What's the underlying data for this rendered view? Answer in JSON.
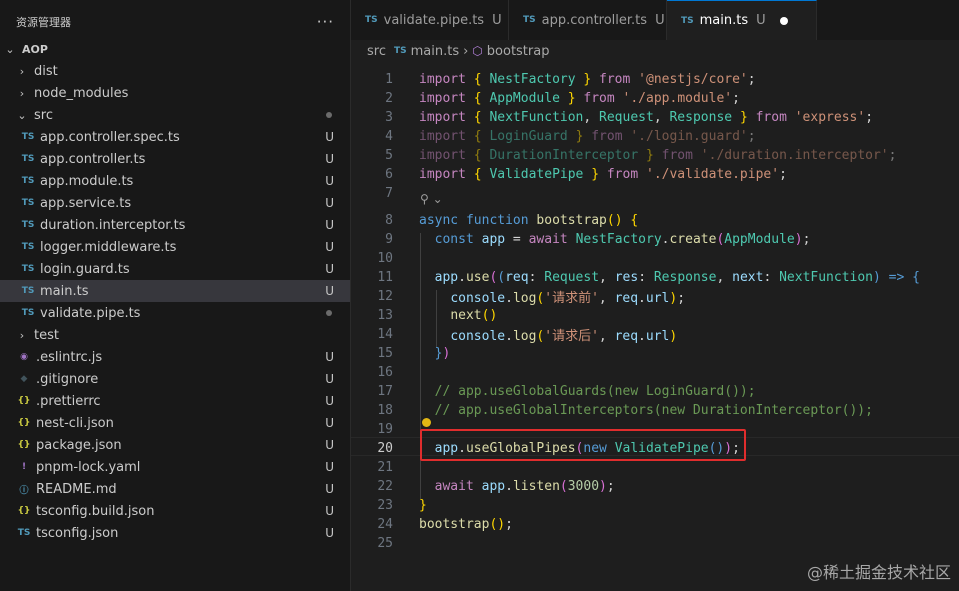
{
  "explorer": {
    "title": "资源管理器",
    "more": "···",
    "root": "AOP",
    "items": [
      {
        "label": "dist",
        "type": "folder",
        "icon": "chevron-right-icon",
        "depth": 1
      },
      {
        "label": "node_modules",
        "type": "folder",
        "icon": "chevron-right-icon",
        "depth": 1
      },
      {
        "label": "src",
        "type": "folder-open",
        "icon": "chevron-down-icon",
        "depth": 1,
        "dot": true
      },
      {
        "label": "app.controller.spec.ts",
        "type": "ts",
        "depth": 2,
        "status": "U"
      },
      {
        "label": "app.controller.ts",
        "type": "ts",
        "depth": 2,
        "status": "U"
      },
      {
        "label": "app.module.ts",
        "type": "ts",
        "depth": 2,
        "status": "U"
      },
      {
        "label": "app.service.ts",
        "type": "ts",
        "depth": 2,
        "status": "U"
      },
      {
        "label": "duration.interceptor.ts",
        "type": "ts",
        "depth": 2,
        "status": "U"
      },
      {
        "label": "logger.middleware.ts",
        "type": "ts",
        "depth": 2,
        "status": "U"
      },
      {
        "label": "login.guard.ts",
        "type": "ts",
        "depth": 2,
        "status": "U"
      },
      {
        "label": "main.ts",
        "type": "ts",
        "depth": 2,
        "status": "U",
        "selected": true
      },
      {
        "label": "validate.pipe.ts",
        "type": "ts",
        "depth": 2,
        "dot": true
      },
      {
        "label": "test",
        "type": "folder",
        "icon": "chevron-right-icon",
        "depth": 1
      },
      {
        "label": ".eslintrc.js",
        "type": "eslint",
        "depth": 1,
        "status": "U"
      },
      {
        "label": ".gitignore",
        "type": "git",
        "depth": 1,
        "status": "U"
      },
      {
        "label": ".prettierrc",
        "type": "json",
        "depth": 1,
        "status": "U"
      },
      {
        "label": "nest-cli.json",
        "type": "json",
        "depth": 1,
        "status": "U"
      },
      {
        "label": "package.json",
        "type": "json",
        "depth": 1,
        "status": "U"
      },
      {
        "label": "pnpm-lock.yaml",
        "type": "yaml",
        "depth": 1,
        "status": "U"
      },
      {
        "label": "README.md",
        "type": "md",
        "depth": 1,
        "status": "U"
      },
      {
        "label": "tsconfig.build.json",
        "type": "json",
        "depth": 1,
        "status": "U"
      },
      {
        "label": "tsconfig.json",
        "type": "tsconfig",
        "depth": 1,
        "status": "U"
      }
    ]
  },
  "tabs": [
    {
      "label": "validate.pipe.ts",
      "status": "U",
      "active": false
    },
    {
      "label": "app.controller.ts",
      "status": "U",
      "active": false
    },
    {
      "label": "main.ts",
      "status": "U",
      "active": true,
      "modified": true
    }
  ],
  "icons": {
    "ts": "TS",
    "json": "{}",
    "yaml": "!",
    "md": "ⓘ",
    "eslint": "◉",
    "git": "◆",
    "chev_right": "›",
    "chev_down": "⌄",
    "symbol": "⬡",
    "codelens": "⚲ ⌄"
  },
  "breadcrumb": {
    "folder": "src",
    "file": "main.ts",
    "symbol": "bootstrap",
    "sep": "›"
  },
  "colors": {
    "accent": "#0078d4",
    "highlight_box": "#e02d2d",
    "bulb": "#e2b714"
  },
  "code_lines": [
    {
      "n": "1",
      "html": "<span class='k'>import</span> <span class='y'>{</span> <span class='t'>NestFactory</span> <span class='y'>}</span> <span class='k'>from</span> <span class='s'>'@nestjs/core'</span>;"
    },
    {
      "n": "2",
      "html": "<span class='k'>import</span> <span class='y'>{</span> <span class='t'>AppModule</span> <span class='y'>}</span> <span class='k'>from</span> <span class='s'>'./app.module'</span>;"
    },
    {
      "n": "3",
      "html": "<span class='k'>import</span> <span class='y'>{</span> <span class='t'>NextFunction</span>, <span class='t'>Request</span>, <span class='t'>Response</span> <span class='y'>}</span> <span class='k'>from</span> <span class='s'>'express'</span>;"
    },
    {
      "n": "4",
      "html": "<span class='dim'><span class='k'>import</span> <span class='y'>{</span> <span class='t'>LoginGuard</span> <span class='y'>}</span> <span class='k'>from</span> <span class='s'>'./login.guard'</span>;</span>"
    },
    {
      "n": "5",
      "html": "<span class='dim'><span class='k'>import</span> <span class='y'>{</span> <span class='t'>DurationInterceptor</span> <span class='y'>}</span> <span class='k'>from</span> <span class='s'>'./duration.interceptor'</span>;</span>"
    },
    {
      "n": "6",
      "html": "<span class='k'>import</span> <span class='y'>{</span> <span class='t'>ValidatePipe</span> <span class='y'>}</span> <span class='k'>from</span> <span class='s'>'./validate.pipe'</span>;"
    },
    {
      "n": "7",
      "html": ""
    },
    {
      "n": "8",
      "html": "<span class='b'>async</span> <span class='b'>function</span> <span class='f'>bootstrap</span><span class='y'>()</span> <span class='y'>{</span>"
    },
    {
      "n": "9",
      "html": "  <span class='b'>const</span> <span class='v'>app</span> = <span class='k'>await</span> <span class='t'>NestFactory</span>.<span class='f'>create</span><span class='p'>(</span><span class='t'>AppModule</span><span class='p'>)</span>;"
    },
    {
      "n": "10",
      "html": ""
    },
    {
      "n": "11",
      "html": "  <span class='v'>app</span>.<span class='f'>use</span><span class='p'>(</span><span class='b'>(</span><span class='v'>req</span>: <span class='t'>Request</span>, <span class='v'>res</span>: <span class='t'>Response</span>, <span class='v'>next</span>: <span class='t'>NextFunction</span><span class='b'>)</span> <span class='b'>=&gt;</span> <span class='b'>{</span>"
    },
    {
      "n": "12",
      "html": "    <span class='v'>console</span>.<span class='f'>log</span><span class='y'>(</span><span class='s'>'请求前'</span>, <span class='v'>req</span>.<span class='v'>url</span><span class='y'>)</span>;"
    },
    {
      "n": "13",
      "html": "    <span class='f'>next</span><span class='y'>()</span>"
    },
    {
      "n": "14",
      "html": "    <span class='v'>console</span>.<span class='f'>log</span><span class='y'>(</span><span class='s'>'请求后'</span>, <span class='v'>req</span>.<span class='v'>url</span><span class='y'>)</span>"
    },
    {
      "n": "15",
      "html": "  <span class='b'>}</span><span class='p'>)</span>"
    },
    {
      "n": "16",
      "html": ""
    },
    {
      "n": "17",
      "html": "  <span class='c'>// app.useGlobalGuards(new LoginGuard());</span>"
    },
    {
      "n": "18",
      "html": "  <span class='c'>// app.useGlobalInterceptors(new DurationInterceptor());</span>"
    },
    {
      "n": "19",
      "html": ""
    },
    {
      "n": "20",
      "html": "  <span class='v'>app</span>.<span class='f'>useGlobalPipes</span><span class='p'>(</span><span class='b'>new</span> <span class='t'>ValidatePipe</span><span class='b'>()</span><span class='p'>)</span>;"
    },
    {
      "n": "21",
      "html": ""
    },
    {
      "n": "22",
      "html": "  <span class='k'>await</span> <span class='v'>app</span>.<span class='f'>listen</span><span class='p'>(</span><span class='n'>3000</span><span class='p'>)</span>;"
    },
    {
      "n": "23",
      "html": "<span class='y'>}</span>"
    },
    {
      "n": "24",
      "html": "<span class='f'>bootstrap</span><span class='y'>()</span>;"
    },
    {
      "n": "25",
      "html": ""
    }
  ],
  "current_line": "20",
  "watermark": "@稀土掘金技术社区"
}
